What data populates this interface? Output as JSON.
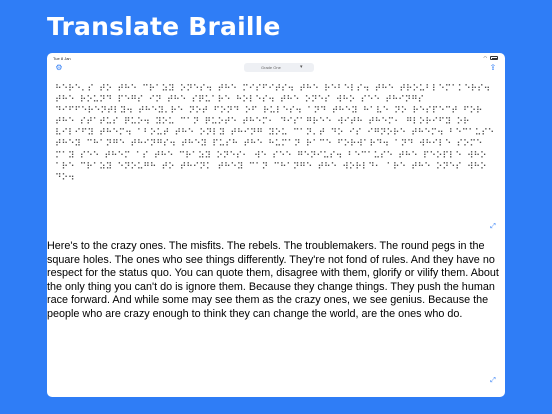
{
  "promo": {
    "title": "Translate Braille"
  },
  "status_bar": {
    "time": "Tue 8 Jan"
  },
  "toolbar": {
    "grade_label": "Grade One"
  },
  "braille": {
    "text": "⠓⠑⠗⠑⠄⠎ ⠞⠕ ⠞⠓⠑ ⠉⠗⠁⠵⠽ ⠕⠝⠑⠎⠲ ⠞⠓⠑ ⠍⠊⠎⠋⠊⠞⠎⠲ ⠞⠓⠑ ⠗⠑⠃⠑⠇⠎⠲ ⠞⠓⠑ ⠞⠗⠕⠥⠃⠇⠑⠍⠁⠅⠑⠗⠎⠲ ⠞⠓⠑ ⠗⠕⠥⠝⠙ ⠏⠑⠛⠎ ⠊⠝ ⠞⠓⠑ ⠎⠟⠥⠁⠗⠑ ⠓⠕⠇⠑⠎⠲ ⠞⠓⠑ ⠕⠝⠑⠎ ⠺⠓⠕ ⠎⠑⠑ ⠞⠓⠊⠝⠛⠎ ⠙⠊⠋⠋⠑⠗⠑⠝⠞⠇⠽⠲ ⠞⠓⠑⠽⠄⠗⠑ ⠝⠕⠞ ⠋⠕⠝⠙ ⠕⠋ ⠗⠥⠇⠑⠎⠲ ⠁⠝⠙ ⠞⠓⠑⠽ ⠓⠁⠧⠑ ⠝⠕ ⠗⠑⠎⠏⠑⠉⠞ ⠋⠕⠗ ⠞⠓⠑ ⠎⠞⠁⠞⠥⠎ ⠟⠥⠕⠲ ⠽⠕⠥ ⠉⠁⠝ ⠟⠥⠕⠞⠑ ⠞⠓⠑⠍⠂ ⠙⠊⠎⠁⠛⠗⠑⠑ ⠺⠊⠞⠓ ⠞⠓⠑⠍⠂ ⠛⠇⠕⠗⠊⠋⠽ ⠕⠗ ⠧⠊⠇⠊⠋⠽ ⠞⠓⠑⠍⠲ ⠁⠃⠕⠥⠞ ⠞⠓⠑ ⠕⠝⠇⠽ ⠞⠓⠊⠝⠛ ⠽⠕⠥ ⠉⠁⠝⠄⠞ ⠙⠕ ⠊⠎ ⠊⠛⠝⠕⠗⠑ ⠞⠓⠑⠍⠲ ⠃⠑⠉⠁⠥⠎⠑ ⠞⠓⠑⠽ ⠉⠓⠁⠝⠛⠑ ⠞⠓⠊⠝⠛⠎⠲ ⠞⠓⠑⠽ ⠏⠥⠎⠓ ⠞⠓⠑ ⠓⠥⠍⠁⠝ ⠗⠁⠉⠑ ⠋⠕⠗⠺⠁⠗⠙⠲ ⠁⠝⠙ ⠺⠓⠊⠇⠑ ⠎⠕⠍⠑ ⠍⠁⠽ ⠎⠑⠑ ⠞⠓⠑⠍ ⠁⠎ ⠞⠓⠑ ⠉⠗⠁⠵⠽ ⠕⠝⠑⠎⠂ ⠺⠑ ⠎⠑⠑ ⠛⠑⠝⠊⠥⠎⠲ ⠃⠑⠉⠁⠥⠎⠑ ⠞⠓⠑ ⠏⠑⠕⠏⠇⠑ ⠺⠓⠕ ⠁⠗⠑ ⠉⠗⠁⠵⠽ ⠑⠝⠕⠥⠛⠓ ⠞⠕ ⠞⠓⠊⠝⠅ ⠞⠓⠑⠽ ⠉⠁⠝ ⠉⠓⠁⠝⠛⠑ ⠞⠓⠑ ⠺⠕⠗⠇⠙⠂ ⠁⠗⠑ ⠞⠓⠑ ⠕⠝⠑⠎ ⠺⠓⠕ ⠙⠕⠲"
  },
  "english": {
    "text": "Here's to the crazy ones. The misfits. The rebels. The troublemakers. The round pegs in the square holes. The ones who see things differently. They're not fond of rules. And they have no respect for the status quo. You can quote them, disagree with them, glorify or vilify them. About the only thing you can't do is ignore them. Because they change things. They push the human race forward. And while some may see them as the crazy ones, we see genius. Because the people who are crazy enough to think they can change the world, are the ones who do."
  },
  "colors": {
    "background": "#2f7df6",
    "accent": "#2f7df6",
    "panel": "#ffffff"
  }
}
